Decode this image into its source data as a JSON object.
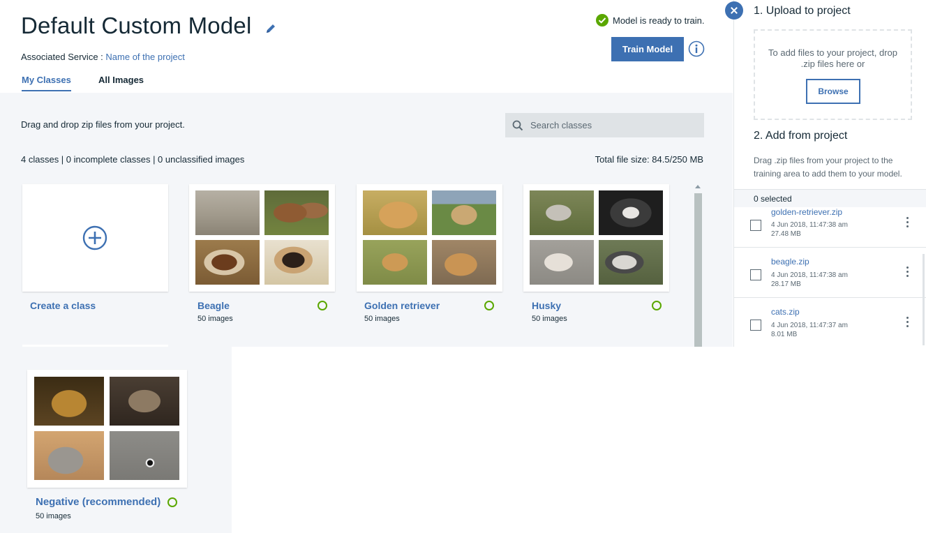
{
  "header": {
    "title": "Default Custom Model",
    "associated_label": "Associated Service :",
    "associated_link": "Name of the project",
    "status_text": "Model is ready to train.",
    "train_button": "Train Model",
    "tabs": [
      {
        "label": "My Classes",
        "active": true
      },
      {
        "label": "All Images",
        "active": false
      }
    ]
  },
  "main": {
    "drag_hint": "Drag and drop zip files from your project.",
    "search_placeholder": "Search classes",
    "counts_text": "4 classes | 0 incomplete classes | 0 unclassified images",
    "file_size_text": "Total file size: 84.5/250 MB",
    "create_class_label": "Create a class",
    "classes": [
      {
        "name": "Beagle",
        "count": "50 images",
        "status": "complete",
        "thumbs": [
          "beagle-photo",
          "beagle-photo",
          "beagle-photo",
          "beagle-photo"
        ]
      },
      {
        "name": "Golden retriever",
        "count": "50 images",
        "status": "complete",
        "thumbs": [
          "golden-retriever-photo",
          "golden-retriever-photo",
          "golden-retriever-photo",
          "golden-retriever-photo"
        ]
      },
      {
        "name": "Husky",
        "count": "50 images",
        "status": "complete",
        "thumbs": [
          "husky-photo",
          "husky-photo",
          "husky-photo",
          "husky-photo"
        ]
      },
      {
        "name": "Negative (recommended)",
        "count": "50 images",
        "status": "complete",
        "thumbs": [
          "cat-photo",
          "cat-photo",
          "cat-photo",
          "cat-photo"
        ]
      }
    ]
  },
  "panel": {
    "step1_title": "1. Upload to project",
    "drop_text": "To add files to your project, drop .zip files here or",
    "browse_button": "Browse",
    "step2_title": "2. Add from project",
    "step2_desc": "Drag .zip files from your project to the training area to add them to your model.",
    "selected_text": "0 selected",
    "files": [
      {
        "name": "golden-retriever.zip",
        "date": "4 Jun 2018, 11:47:38 am",
        "size": "27.48 MB"
      },
      {
        "name": "beagle.zip",
        "date": "4 Jun 2018, 11:47:38 am",
        "size": "28.17 MB"
      },
      {
        "name": "cats.zip",
        "date": "4 Jun 2018, 11:47:37 am",
        "size": "8.01 MB"
      }
    ]
  },
  "colors": {
    "accent": "#3d70b2",
    "success": "#5aa700",
    "background_gray": "#f4f6f9",
    "text": "#152935"
  },
  "icons": [
    "edit-icon",
    "check-circle-icon",
    "info-icon",
    "search-icon",
    "plus-circle-icon",
    "close-icon",
    "kebab-menu-icon"
  ]
}
